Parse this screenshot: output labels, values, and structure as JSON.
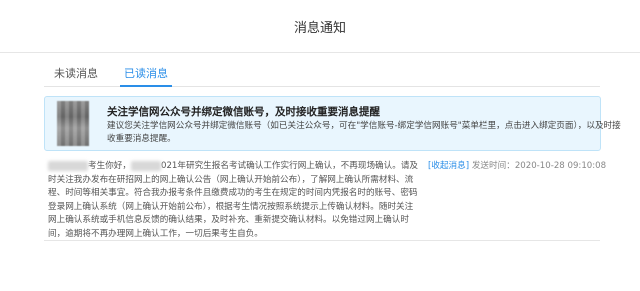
{
  "header": {
    "title": "消息通知"
  },
  "tabs": [
    {
      "label": "未读消息"
    },
    {
      "label": "已读消息"
    }
  ],
  "notice": {
    "title": "关注学信网公众号并绑定微信账号，及时接收重要消息提醒",
    "body": "建议您关注学信网公众号并绑定微信账号（如已关注公众号，可在\"学信账号-绑定学信网账号\"菜单栏里，点击进入绑定页面），以及时接收重要消息提醒。"
  },
  "message": {
    "text_part1": "考生你好，",
    "text_part2": "021年研究生报名考试确认工作实行网上确认，不再现场确认。请及时关注我办发布在研招网上的网上确认公告（网上确认开始前公布），了解网上确认所需材料、流程、时间等相关事宜。符合我办报考条件且缴费成功的考生在规定的时间内凭报名时的账号、密码登录网上确认系统（网上确认开始前公布），根据考生情况按照系统提示上传确认材料。随时关注网上确认系统或手机信息反馈的确认结果，及时补充、重新提交确认材料。以免错过网上确认时间，逾期将不再办理网上确认工作，一切后果考生自负。",
    "collapse_label": "[收起消息]",
    "send_label": "发送时间：",
    "send_time": "2020-10-28 09:10:08"
  },
  "colors": {
    "accent": "#2a8ee8",
    "notice_bg": "#e9f6fe"
  }
}
